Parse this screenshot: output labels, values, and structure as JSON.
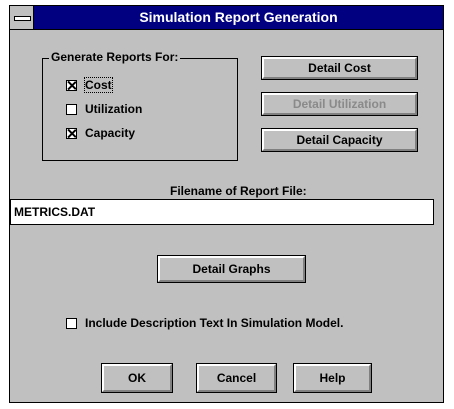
{
  "window": {
    "title": "Simulation Report Generation"
  },
  "group": {
    "legend": "Generate Reports For:",
    "options": [
      {
        "label": "Cost",
        "checked": true
      },
      {
        "label": "Utilization",
        "checked": false
      },
      {
        "label": "Capacity",
        "checked": true
      }
    ]
  },
  "buttons": {
    "detail_cost": "Detail Cost",
    "detail_utilization": "Detail Utilization",
    "detail_capacity": "Detail Capacity",
    "detail_graphs": "Detail Graphs",
    "ok": "OK",
    "cancel": "Cancel",
    "help": "Help"
  },
  "filename": {
    "label": "Filename of Report File:",
    "value": "METRICS.DAT"
  },
  "include_description": {
    "label": "Include Description Text In Simulation Model.",
    "checked": false
  }
}
